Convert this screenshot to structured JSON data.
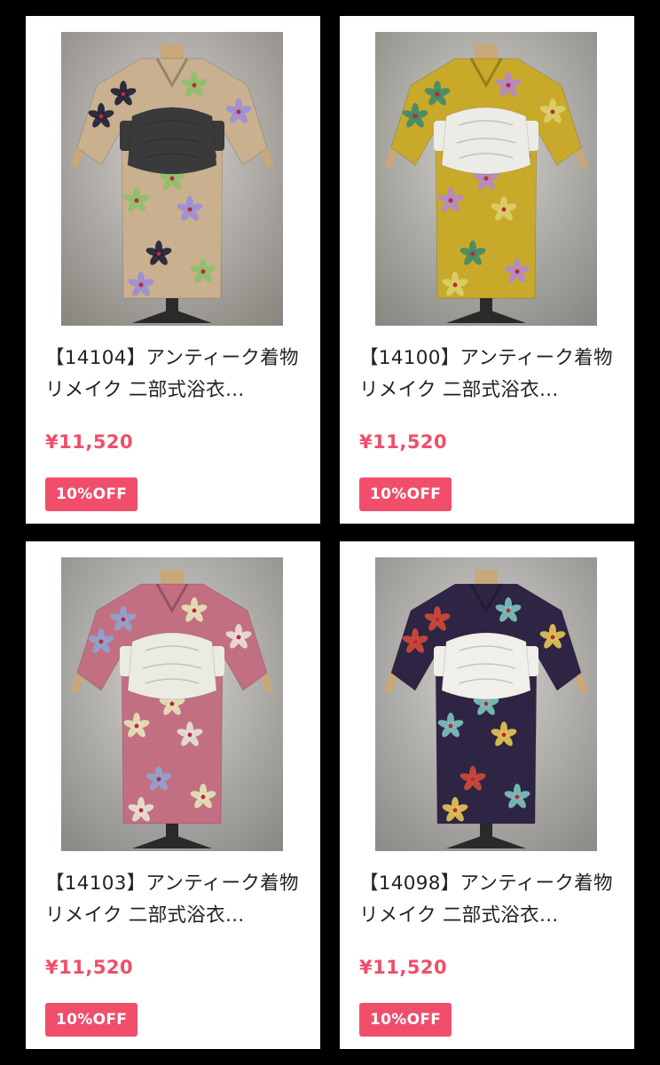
{
  "theme": {
    "price_color": "#f04e6b",
    "badge_color": "#f04e6b"
  },
  "products": [
    {
      "title": "【14104】アンティーク着物リメイク 二部式浴衣…",
      "price": "¥11,520",
      "badge": "10%OFF",
      "image": {
        "bg": "#8a8680",
        "body": "#c9b08f",
        "obi": "#3a3a3c",
        "accent": "#1d1f33",
        "accent2": "#8ec06a",
        "accent3": "#9a8fd8"
      }
    },
    {
      "title": "【14100】アンティーク着物リメイク 二部式浴衣…",
      "price": "¥11,520",
      "badge": "10%OFF",
      "image": {
        "bg": "#8a8882",
        "body": "#c9a92a",
        "obi": "#ecebe6",
        "accent": "#3f8a6a",
        "accent2": "#b48ac8",
        "accent3": "#d9d06a"
      }
    },
    {
      "title": "【14103】アンティーク着物リメイク 二部式浴衣…",
      "price": "¥11,520",
      "badge": "10%OFF",
      "image": {
        "bg": "#8c8a86",
        "body": "#c26f82",
        "obi": "#ecebe3",
        "accent": "#8fa4cf",
        "accent2": "#e5e4b8",
        "accent3": "#e9e2d6"
      }
    },
    {
      "title": "【14098】アンティーク着物リメイク 二部式浴衣…",
      "price": "¥11,520",
      "badge": "10%OFF",
      "image": {
        "bg": "#8e8c88",
        "body": "#2e2443",
        "obi": "#f0efe9",
        "accent": "#d04a3c",
        "accent2": "#7ec4c0",
        "accent3": "#e6c855"
      }
    }
  ]
}
